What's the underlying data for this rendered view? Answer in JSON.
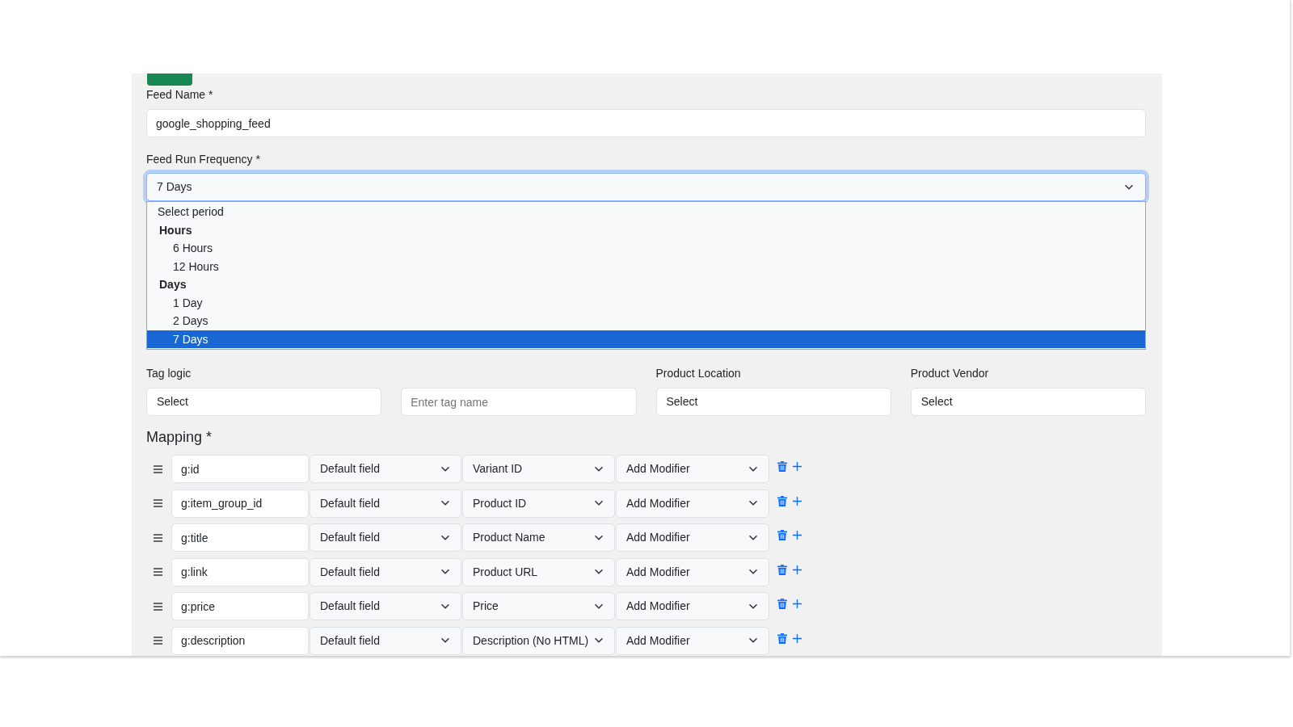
{
  "feed_name": {
    "label": "Feed Name *",
    "value": "google_shopping_feed"
  },
  "feed_run_frequency": {
    "label": "Feed Run Frequency *",
    "value": "7 Days",
    "expanded": true,
    "options": [
      {
        "kind": "option",
        "label": "Select period",
        "selected": false
      },
      {
        "kind": "group",
        "label": "Hours",
        "children": [
          {
            "label": "6 Hours",
            "selected": false
          },
          {
            "label": "12 Hours",
            "selected": false
          }
        ]
      },
      {
        "kind": "group",
        "label": "Days",
        "children": [
          {
            "label": "1 Day",
            "selected": false
          },
          {
            "label": "2 Days",
            "selected": false
          },
          {
            "label": "7 Days",
            "selected": true
          }
        ]
      }
    ]
  },
  "filters": [
    {
      "kind": "select",
      "label": "Tag logic",
      "value": "Select"
    },
    {
      "kind": "input",
      "placeholder": "Enter tag name"
    },
    {
      "kind": "select",
      "label": "Product Location",
      "value": "Select"
    },
    {
      "kind": "select",
      "label": "Product Vendor",
      "value": "Select"
    }
  ],
  "mapping": {
    "title": "Mapping *",
    "rows": [
      {
        "attribute": "g:id",
        "field_type": "Default field",
        "source": "Variant ID",
        "modifier": "Add Modifier"
      },
      {
        "attribute": "g:item_group_id",
        "field_type": "Default field",
        "source": "Product ID",
        "modifier": "Add Modifier"
      },
      {
        "attribute": "g:title",
        "field_type": "Default field",
        "source": "Product Name",
        "modifier": "Add Modifier"
      },
      {
        "attribute": "g:link",
        "field_type": "Default field",
        "source": "Product URL",
        "modifier": "Add Modifier"
      },
      {
        "attribute": "g:price",
        "field_type": "Default field",
        "source": "Price",
        "modifier": "Add Modifier"
      },
      {
        "attribute": "g:description",
        "field_type": "Default field",
        "source": "Description (No HTML)",
        "modifier": "Add Modifier"
      }
    ]
  }
}
